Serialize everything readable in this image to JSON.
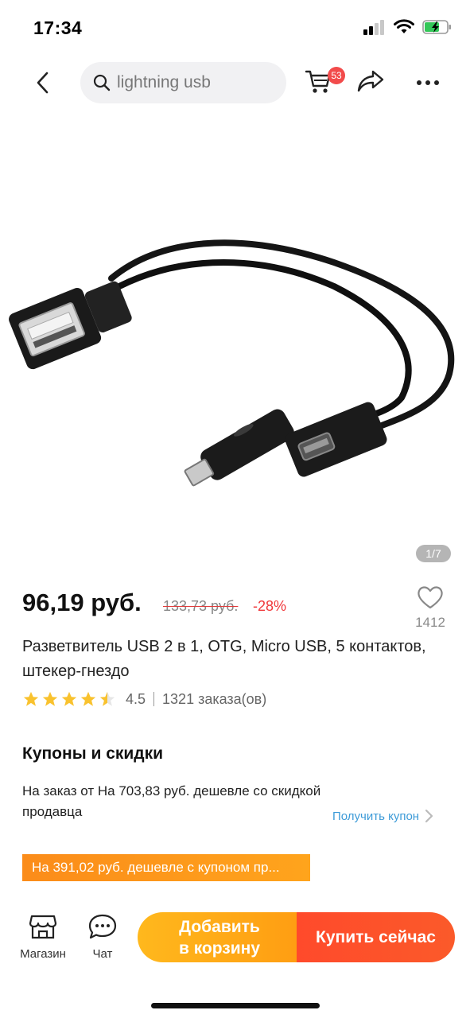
{
  "status": {
    "time": "17:34"
  },
  "header": {
    "search_placeholder": "lightning usb",
    "cart_count": "53"
  },
  "gallery": {
    "page_indicator": "1/7"
  },
  "product": {
    "price": "96,19 руб.",
    "old_price": "133,73 руб.",
    "discount": "-28%",
    "wishlist_count": "1412",
    "title": "Разветвитель USB 2 в 1, OTG, Micro USB, 5 контактов, штекер-гнездо",
    "rating": "4.5",
    "rating_fraction": 0.9,
    "orders": "1321 заказа(ов)"
  },
  "coupons": {
    "section_title": "Купоны и скидки",
    "description": "На заказ от На 703,83 руб. дешевле со скидкой продавца",
    "get_coupon_label": "Получить купон",
    "promo_banner": "На 391,02 руб. дешевле с купоном пр..."
  },
  "bottom_bar": {
    "store_label": "Магазин",
    "chat_label": "Чат",
    "add_to_cart_line1": "Добавить",
    "add_to_cart_line2": "в корзину",
    "buy_now_label": "Купить сейчас"
  },
  "colors": {
    "accent_orange": "#ff9d12",
    "accent_red": "#ff4a2b",
    "discount_red": "#f0373a",
    "link_blue": "#3d9bd8",
    "star_yellow": "#f9c22e"
  },
  "icons": [
    "back-arrow-icon",
    "search-icon",
    "cart-icon",
    "share-icon",
    "more-icon",
    "heart-icon",
    "star-icon",
    "chevron-right-icon",
    "store-icon",
    "chat-icon"
  ]
}
